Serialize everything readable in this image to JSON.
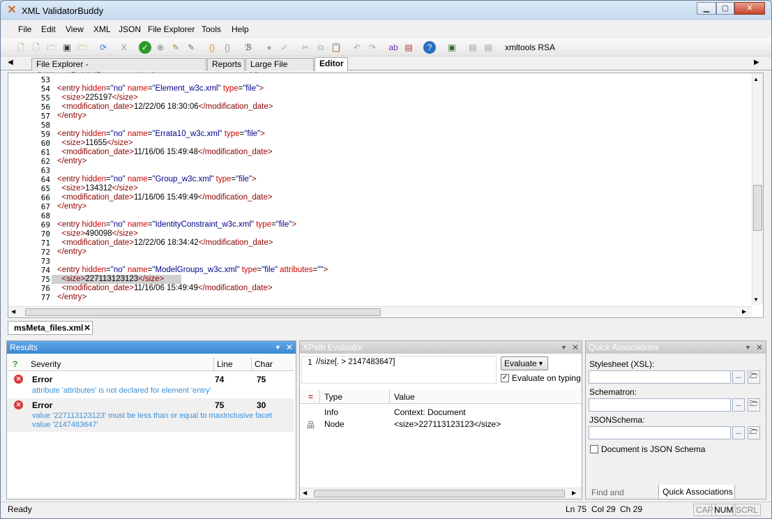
{
  "title": "XML ValidatorBuddy",
  "menu": [
    "File",
    "Edit",
    "View",
    "XML",
    "JSON",
    "File Explorer",
    "Tools",
    "Help"
  ],
  "toolbar_label": "xmltools RSA",
  "tabs": [
    "File Explorer - C:\\Users\\Public\\Documents\\xml",
    "Reports",
    "Large File Viewer",
    "Editor"
  ],
  "lines": [
    {
      "n": "53",
      "t": ""
    },
    {
      "n": "54",
      "t": "<entry hidden=\"no\" name=\"Element_w3c.xml\" type=\"file\">"
    },
    {
      "n": "55",
      "t": "  <size>225197</size>"
    },
    {
      "n": "56",
      "t": "  <modification_date>12/22/06 18:30:06</modification_date>"
    },
    {
      "n": "57",
      "t": "</entry>"
    },
    {
      "n": "58",
      "t": ""
    },
    {
      "n": "59",
      "t": "<entry hidden=\"no\" name=\"Errata10_w3c.xml\" type=\"file\">"
    },
    {
      "n": "60",
      "t": "  <size>11655</size>"
    },
    {
      "n": "61",
      "t": "  <modification_date>11/16/06 15:49:48</modification_date>"
    },
    {
      "n": "62",
      "t": "</entry>"
    },
    {
      "n": "63",
      "t": ""
    },
    {
      "n": "64",
      "t": "<entry hidden=\"no\" name=\"Group_w3c.xml\" type=\"file\">"
    },
    {
      "n": "65",
      "t": "  <size>134312</size>"
    },
    {
      "n": "66",
      "t": "  <modification_date>11/16/06 15:49:49</modification_date>"
    },
    {
      "n": "67",
      "t": "</entry>"
    },
    {
      "n": "68",
      "t": ""
    },
    {
      "n": "69",
      "t": "<entry hidden=\"no\" name=\"IdentityConstraint_w3c.xml\" type=\"file\">"
    },
    {
      "n": "70",
      "t": "  <size>490098</size>"
    },
    {
      "n": "71",
      "t": "  <modification_date>12/22/06 18:34:42</modification_date>"
    },
    {
      "n": "72",
      "t": "</entry>"
    },
    {
      "n": "73",
      "t": ""
    },
    {
      "n": "74",
      "t": "<entry hidden=\"no\" name=\"ModelGroups_w3c.xml\" type=\"file\" attributes=\"\">"
    },
    {
      "n": "75",
      "t": "  <size>227113123123</size>"
    },
    {
      "n": "76",
      "t": "  <modification_date>11/16/06 15:49:49</modification_date>"
    },
    {
      "n": "77",
      "t": "</entry>"
    }
  ],
  "doc_tab": "msMeta_files.xml",
  "results": {
    "title": "Results",
    "cols": [
      "Severity",
      "Line",
      "Char"
    ],
    "rows": [
      {
        "sev": "Error",
        "line": "74",
        "char": "75",
        "msg": "attribute 'attributes' is not declared for element 'entry'"
      },
      {
        "sev": "Error",
        "line": "75",
        "char": "30",
        "msg": "value '227113123123' must be less than or equal to maxInclusive facet value '2147483647'"
      }
    ]
  },
  "xpath": {
    "title": "XPath Evaluator",
    "expr_line": "1",
    "expr": "//size[. > 2147483647]",
    "evaluate": "Evaluate",
    "on_typing": "Evaluate on typing",
    "cols": [
      "Type",
      "Value"
    ],
    "rows": [
      {
        "type": "Info",
        "value": "Context: Document"
      },
      {
        "type": "Node",
        "value": "<size>227113123123</size>"
      }
    ]
  },
  "quick": {
    "title": "Quick Associations",
    "xsl": "Stylesheet (XSL):",
    "sch": "Schematron:",
    "json": "JSONSchema:",
    "is_json": "Document is JSON Schema",
    "tab1": "Find and Replace",
    "tab2": "Quick Associations"
  },
  "status": {
    "ready": "Ready",
    "ln": "Ln 75",
    "col": "Col 29",
    "ch": "Ch 29",
    "cap": "CAP",
    "num": "NUM",
    "scrl": "SCRL"
  }
}
